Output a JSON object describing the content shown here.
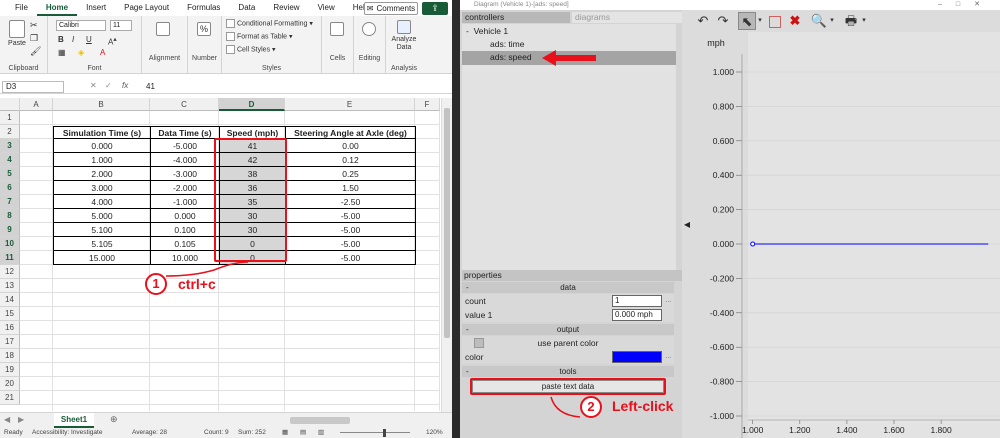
{
  "excel": {
    "ribbon_tabs": [
      "File",
      "Home",
      "Insert",
      "Page Layout",
      "Formulas",
      "Data",
      "Review",
      "View",
      "Help"
    ],
    "active_tab": "Home",
    "comments_label": "Comments",
    "clipboard": {
      "paste": "Paste",
      "label": "Clipboard"
    },
    "font": {
      "name": "Calibri",
      "size": "11",
      "label": "Font",
      "bold": "B",
      "italic": "I",
      "underline": "U"
    },
    "alignment_label": "Alignment",
    "number_label": "Number",
    "styles": {
      "cond_fmt": "Conditional Formatting",
      "format_table": "Format as Table",
      "cell_styles": "Cell Styles",
      "label": "Styles"
    },
    "cells_label": "Cells",
    "editing_label": "Editing",
    "analysis": {
      "btn": "Analyze Data",
      "label": "Analysis"
    },
    "name_box": "D3",
    "fx": "fx",
    "formula_value": "41",
    "columns": [
      "A",
      "B",
      "C",
      "D",
      "E",
      "F"
    ],
    "selected_column": "D",
    "rows": [
      "1",
      "2",
      "3",
      "4",
      "5",
      "6",
      "7",
      "8",
      "9",
      "10",
      "11",
      "12",
      "13",
      "14",
      "15",
      "16",
      "17",
      "18",
      "19",
      "20",
      "21"
    ],
    "table": {
      "headers": [
        "Simulation Time (s)",
        "Data Time (s)",
        "Speed (mph)",
        "Steering Angle at Axle (deg)"
      ],
      "rows": [
        [
          "0.000",
          "-5.000",
          "41",
          "0.00"
        ],
        [
          "1.000",
          "-4.000",
          "42",
          "0.12"
        ],
        [
          "2.000",
          "-3.000",
          "38",
          "0.25"
        ],
        [
          "3.000",
          "-2.000",
          "36",
          "1.50"
        ],
        [
          "4.000",
          "-1.000",
          "35",
          "-2.50"
        ],
        [
          "5.000",
          "0.000",
          "30",
          "-5.00"
        ],
        [
          "5.100",
          "0.100",
          "30",
          "-5.00"
        ],
        [
          "5.105",
          "0.105",
          "0",
          "-5.00"
        ],
        [
          "15.000",
          "10.000",
          "0",
          "-5.00"
        ]
      ]
    },
    "sheet_tab": "Sheet1",
    "status": {
      "ready": "Ready",
      "accessibility": "Accessibility: Investigate",
      "average": "Average: 28",
      "count": "Count: 9",
      "sum": "Sum: 252",
      "zoom": "120%"
    }
  },
  "callouts": {
    "step1_num": "1",
    "step1_text": "ctrl+c",
    "step2_num": "2",
    "step2_text": "Left-click"
  },
  "diagram": {
    "title": "Diagram (Vehicle 1)-[ads: speed]",
    "tabs": {
      "controllers": "controllers",
      "diagrams": "diagrams"
    },
    "tree": {
      "parent": "Vehicle 1",
      "children": [
        "ads: time",
        "ads: speed"
      ]
    },
    "properties_label": "properties",
    "sections": {
      "data": "data",
      "output": "output",
      "tools": "tools"
    },
    "props": {
      "count_label": "count",
      "count_value": "1",
      "value1_label": "value 1",
      "value1_value": "0.000 mph",
      "use_parent_color": "use parent color",
      "color_label": "color",
      "color_value": "#0000ff"
    },
    "paste_button": "paste text data",
    "accent_red": "#e8101a"
  },
  "chart_data": {
    "type": "line",
    "ylabel": "mph",
    "ylim": [
      -1.0,
      1.0
    ],
    "y_ticks": [
      "1.000",
      "0.800",
      "0.600",
      "0.400",
      "0.200",
      "0.000",
      "-0.200",
      "-0.400",
      "-0.600",
      "-0.800",
      "-1.000"
    ],
    "x_ticks": [
      "1.000",
      "1.200",
      "1.400",
      "1.600",
      "1.800"
    ],
    "series": [
      {
        "x": [
          1.0,
          2.0
        ],
        "y": [
          0.0,
          0.0
        ],
        "color": "#0000ff"
      }
    ]
  }
}
